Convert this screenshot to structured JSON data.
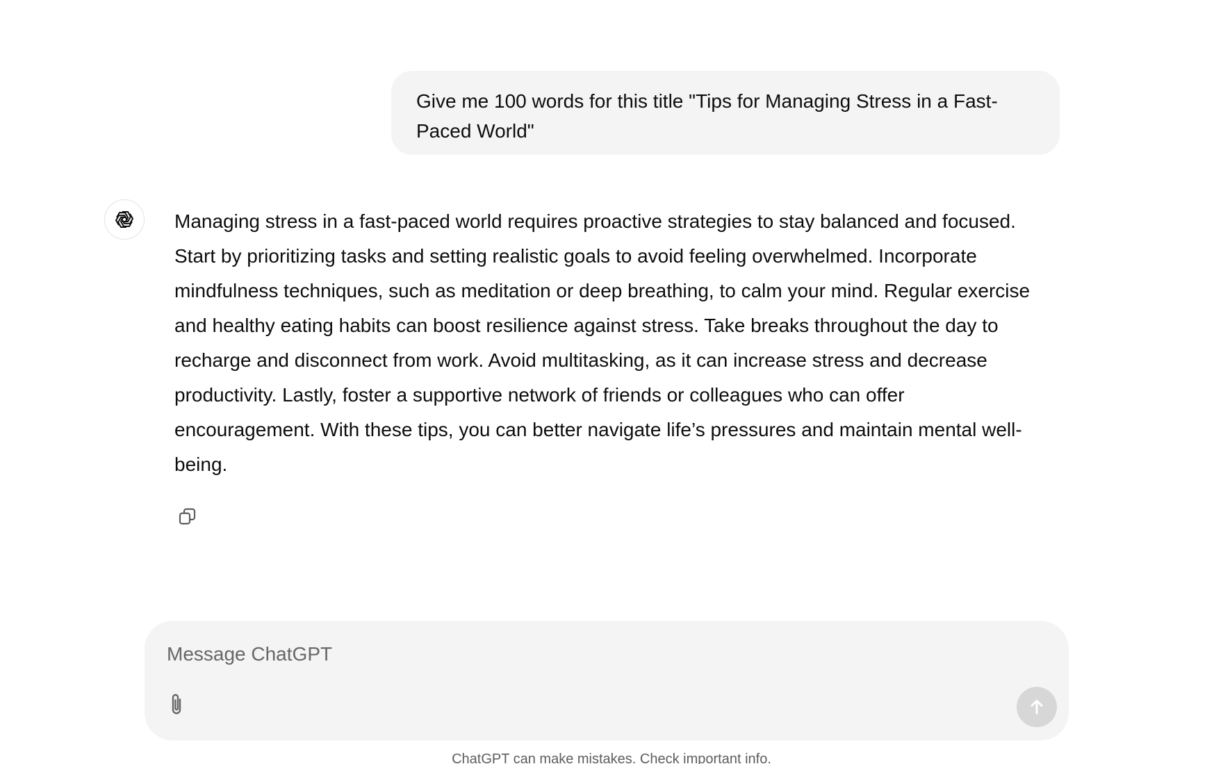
{
  "conversation": {
    "user_message": "Give me 100 words for this title \"Tips for Managing Stress in a Fast-Paced World\"",
    "assistant_message": "Managing stress in a fast-paced world requires proactive strategies to stay balanced and focused. Start by prioritizing tasks and setting realistic goals to avoid feeling overwhelmed. Incorporate mindfulness techniques, such as meditation or deep breathing, to calm your mind. Regular exercise and healthy eating habits can boost resilience against stress. Take breaks throughout the day to recharge and disconnect from work. Avoid multitasking, as it can increase stress and decrease productivity. Lastly, foster a supportive network of friends or colleagues who can offer encouragement. With these tips, you can better navigate life’s pressures and maintain mental well-being.",
    "assistant_avatar_icon": "openai-logo-icon",
    "copy_icon": "copy-icon"
  },
  "composer": {
    "placeholder": "Message ChatGPT",
    "value": "",
    "attach_icon": "paperclip-icon",
    "send_icon": "arrow-up-icon"
  },
  "footer": {
    "disclaimer": "ChatGPT can make mistakes. Check important info."
  },
  "colors": {
    "bubble_bg": "#f4f4f4",
    "send_button_disabled": "#d7d7d7",
    "text": "#0d0d0d"
  }
}
